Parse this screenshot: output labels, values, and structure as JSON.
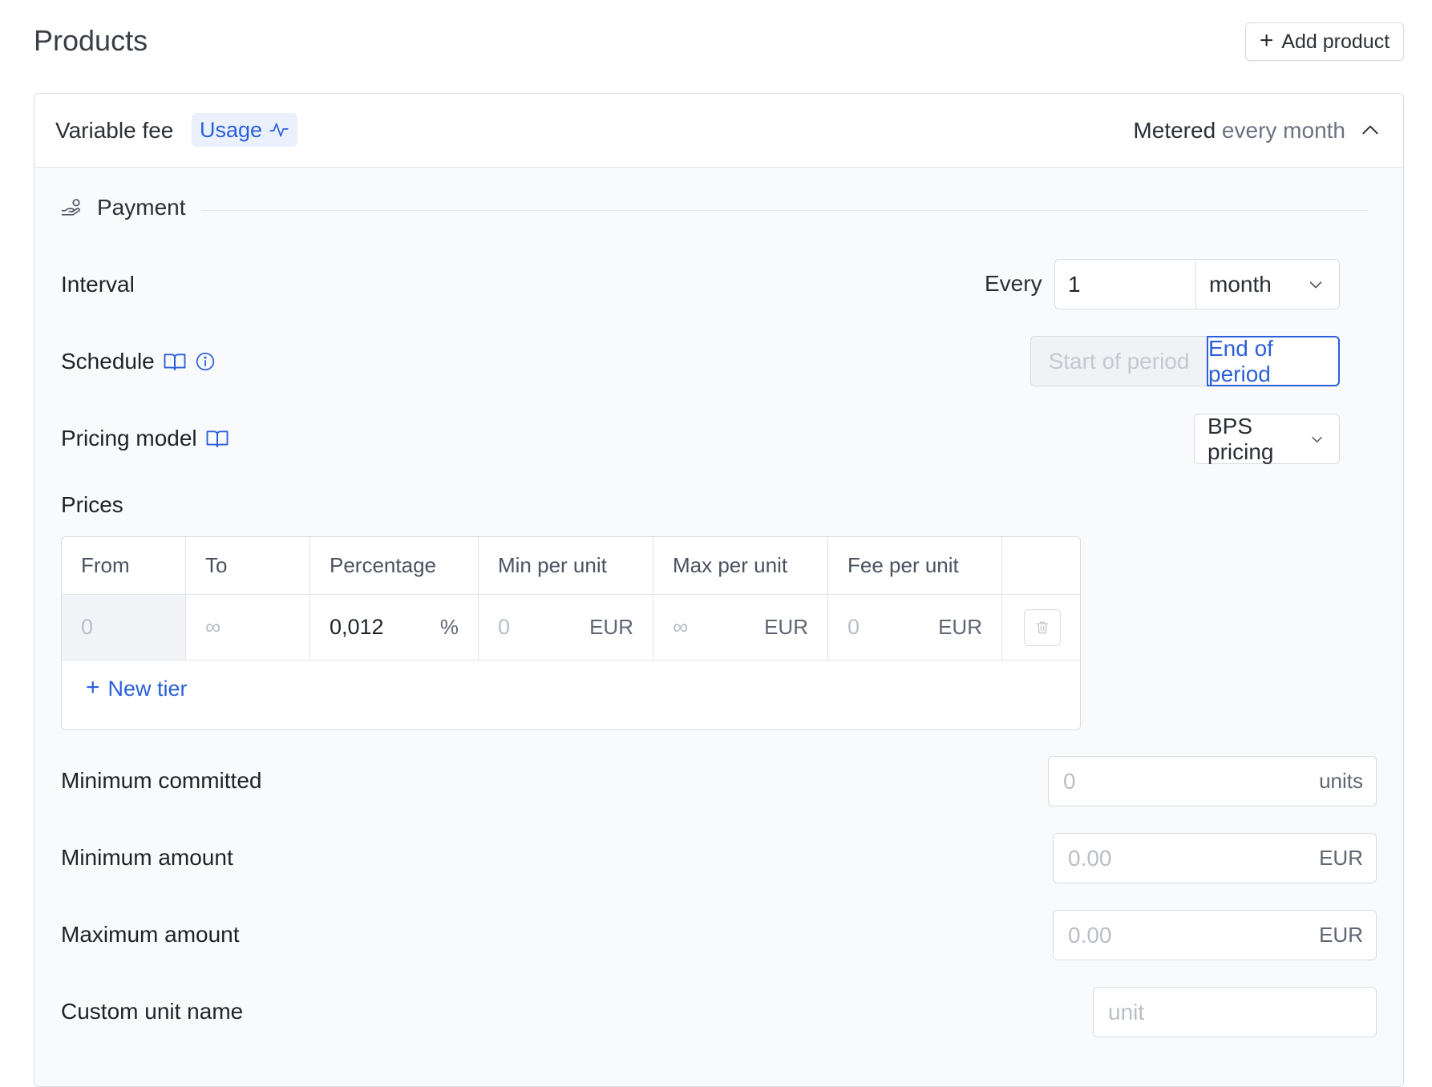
{
  "page": {
    "title": "Products",
    "add_button_label": "Add product"
  },
  "product": {
    "name": "Variable fee",
    "badge": "Usage",
    "billing_mode": "Metered",
    "billing_frequency": "every month"
  },
  "payment": {
    "section_label": "Payment",
    "interval": {
      "label": "Interval",
      "every_label": "Every",
      "value": "1",
      "unit": "month"
    },
    "schedule": {
      "label": "Schedule",
      "options": [
        "Start of period",
        "End of period"
      ],
      "selected": "End of period"
    },
    "pricing_model": {
      "label": "Pricing model",
      "value": "BPS pricing"
    },
    "prices": {
      "label": "Prices",
      "columns": [
        "From",
        "To",
        "Percentage",
        "Min per unit",
        "Max per unit",
        "Fee per unit"
      ],
      "rows": [
        {
          "from": "0",
          "to": "∞",
          "percentage": "0,012",
          "percentage_unit": "%",
          "min": "0",
          "min_unit": "EUR",
          "max": "∞",
          "max_unit": "EUR",
          "fee": "0",
          "fee_unit": "EUR"
        }
      ],
      "new_tier_label": "New tier"
    },
    "minimum_committed": {
      "label": "Minimum committed",
      "placeholder": "0",
      "suffix": "units"
    },
    "minimum_amount": {
      "label": "Minimum amount",
      "placeholder": "0.00",
      "suffix": "EUR"
    },
    "maximum_amount": {
      "label": "Maximum amount",
      "placeholder": "0.00",
      "suffix": "EUR"
    },
    "custom_unit_name": {
      "label": "Custom unit name",
      "placeholder": "unit"
    }
  },
  "colors": {
    "accent": "#2b5fd9",
    "badge_bg": "#eaf1fd",
    "panel_bg": "#f8fafc",
    "border": "#d7dbe0"
  },
  "icons": [
    "plus-icon",
    "activity-icon",
    "chevron-up-icon",
    "hand-coins-icon",
    "book-icon",
    "info-icon",
    "chevron-down-icon",
    "trash-icon"
  ]
}
